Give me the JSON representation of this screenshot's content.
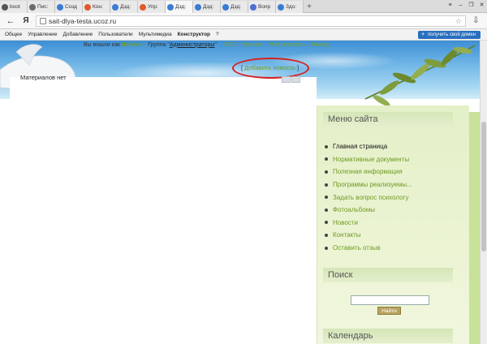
{
  "browser": {
    "tabs": [
      {
        "label": "boot",
        "color": "#555555"
      },
      {
        "label": "Пис:",
        "color": "#6a6a6a"
      },
      {
        "label": "Созд",
        "color": "#3a7bd5"
      },
      {
        "label": "Кон:",
        "color": "#e05a2b"
      },
      {
        "label": "Дзд:",
        "color": "#3a7bd5"
      },
      {
        "label": "Упр:",
        "color": "#e05a2b"
      },
      {
        "label": "Дзд:",
        "color": "#3a7bd5"
      },
      {
        "label": "Дзд:",
        "color": "#3a7bd5"
      },
      {
        "label": "Дзд:",
        "color": "#3a7bd5"
      },
      {
        "label": "Вопр",
        "color": "#4a6fd0"
      },
      {
        "label": "Здо:",
        "color": "#3a7bd5"
      }
    ],
    "active_tab_index": 6,
    "url": "sait-dlya-testa.ucoz.ru"
  },
  "ucoz_bar": {
    "menu": [
      "Общее",
      "Управление",
      "Добавление",
      "Пользователи",
      "Мультимедиа",
      "Конструктор",
      "?"
    ],
    "bold_index": 5,
    "domain_button": "получить свой домен"
  },
  "userline": {
    "prefix": "Вы вошли как",
    "username": "Believe",
    "group_label": "Группа",
    "group_name": "Администраторы",
    "links": [
      "RSS",
      "Главная",
      "Мой профиль",
      "Выход"
    ]
  },
  "main": {
    "add_news": "Добавить новость",
    "no_materials": "Материалов нет"
  },
  "sidebar": {
    "menu_title": "Меню сайта",
    "menu_items": [
      "Главная страница",
      "Нормативные документы",
      "Полезная информация",
      "Программы реализуемы...",
      "Задать вопрос психологу",
      "Фотоальбомы",
      "Новости",
      "Контакты",
      "Оставить отзыв"
    ],
    "search_title": "Поиск",
    "search_button": "Найти",
    "calendar_title": "Календарь"
  },
  "colors": {
    "accent_green": "#6e9a22",
    "highlight_red": "#d82020",
    "domain_button_blue": "#2a6fbf"
  }
}
